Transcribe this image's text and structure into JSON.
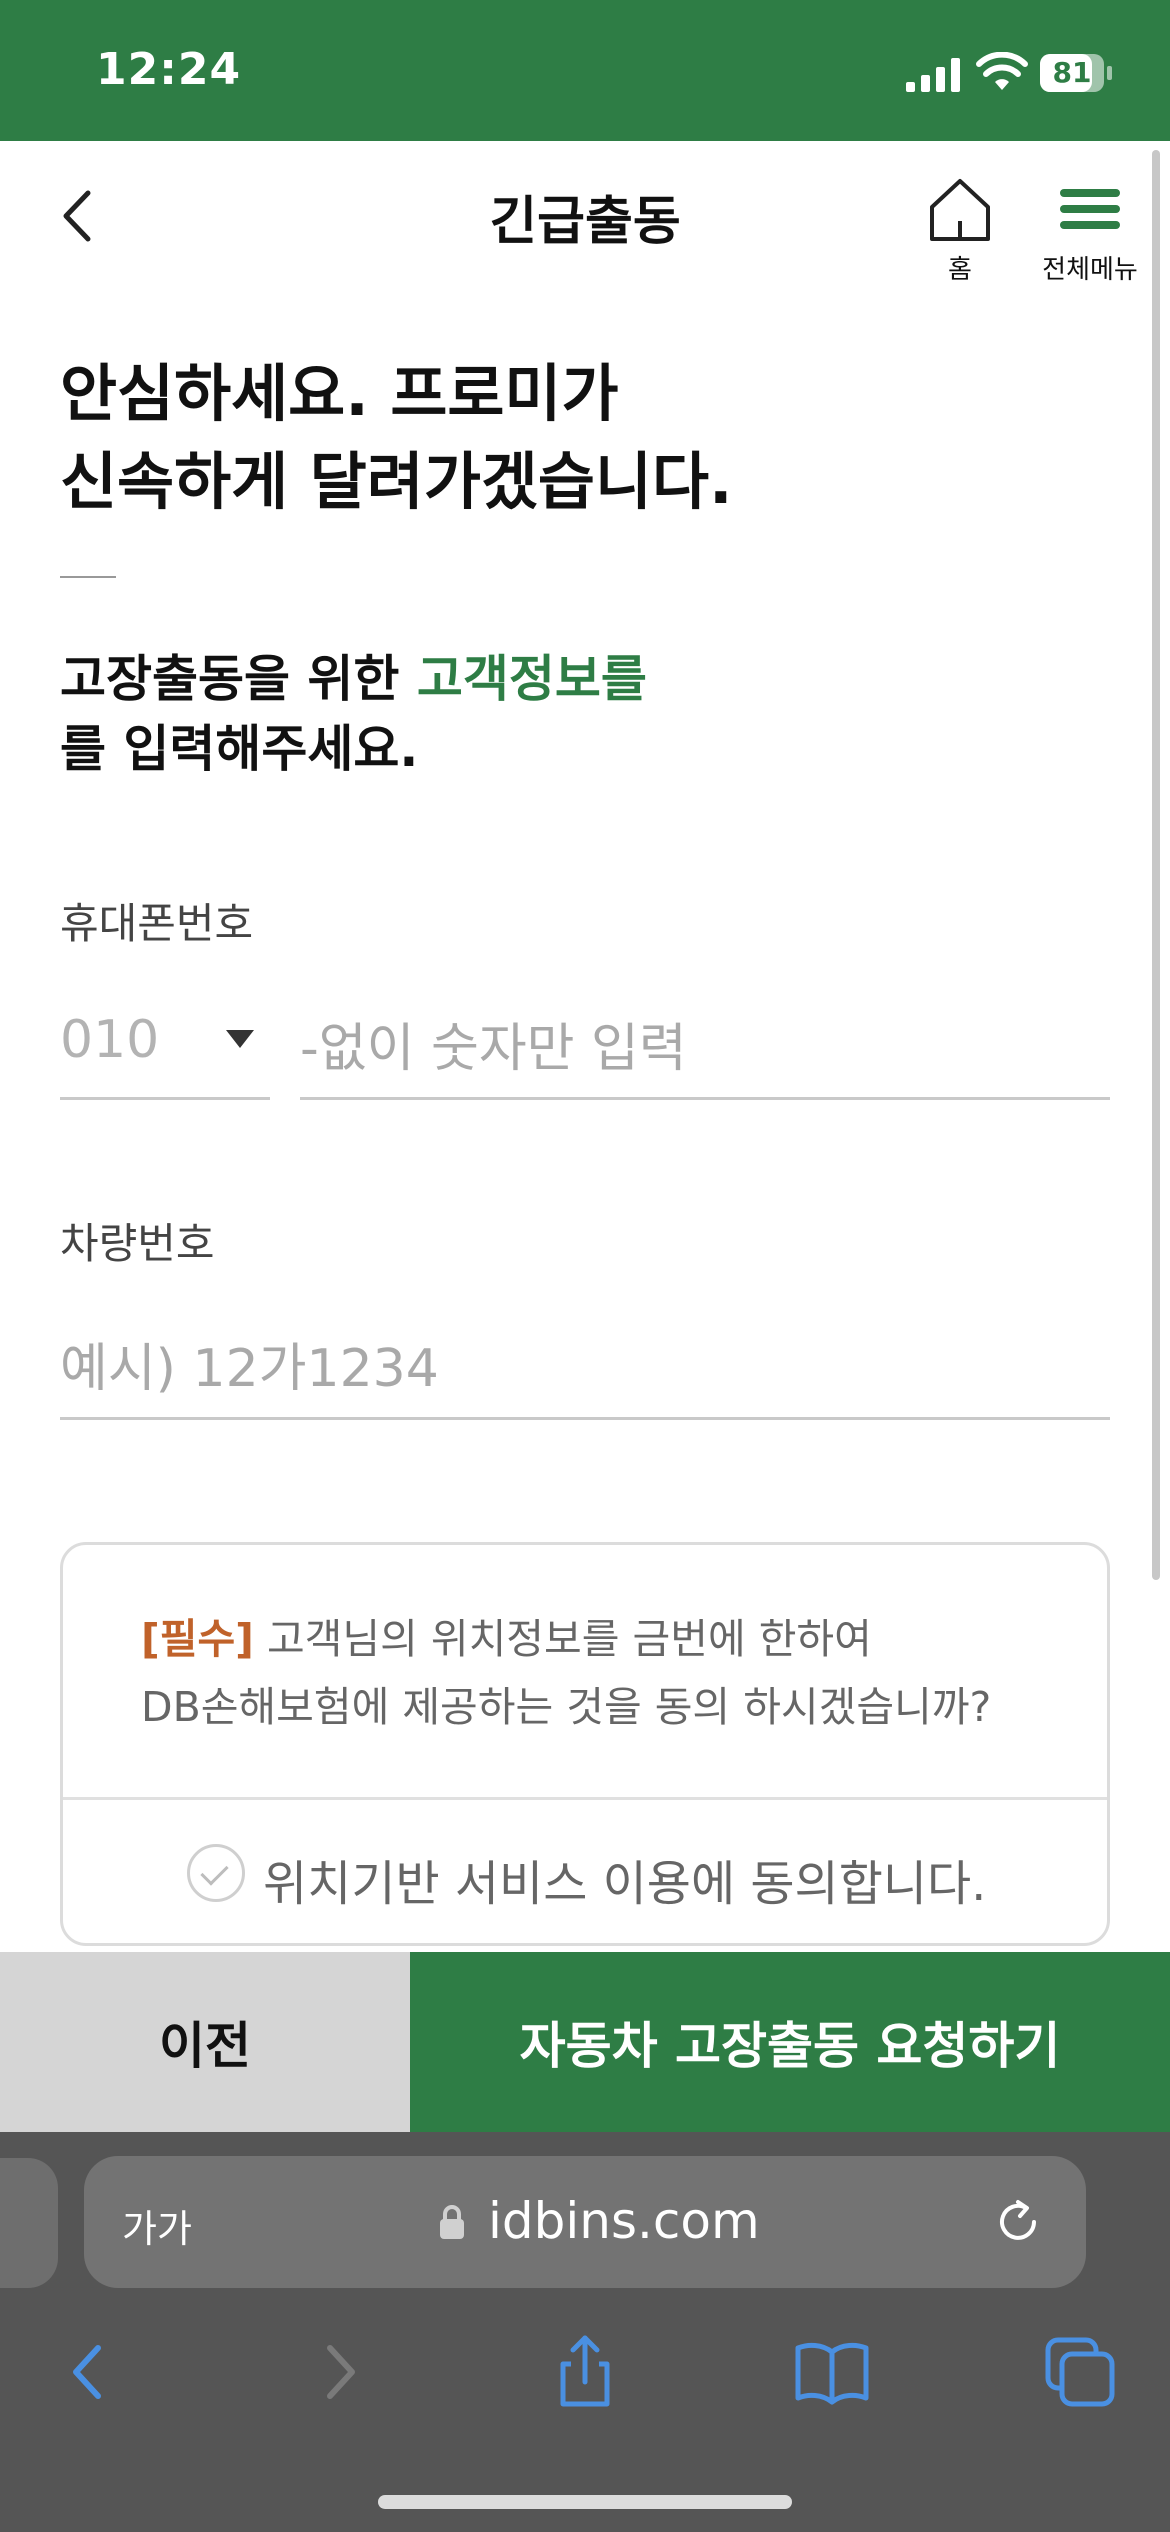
{
  "status_bar": {
    "time": "12:24",
    "battery": "81"
  },
  "header": {
    "title": "긴급출동",
    "home_label": "홈",
    "menu_label": "전체메뉴"
  },
  "headline": {
    "line1": "안심하세요. 프로미가",
    "line2": "신속하게 달려가겠습니다."
  },
  "subhead": {
    "prefix": "고장출동을 위한 ",
    "accent": "고객정보를",
    "suffix": "를 입력해주세요."
  },
  "phone": {
    "label": "휴대폰번호",
    "prefix_value": "010",
    "placeholder": "-없이 숫자만 입력"
  },
  "vehicle": {
    "label": "차량번호",
    "placeholder": "예시) 12가1234"
  },
  "consent": {
    "required_tag": "[필수]",
    "text_line1": " 고객님의 위치정보를 금번에 한하여",
    "text_line2": "DB손해보험에 제공하는 것을 동의 하시겠습니까?",
    "agree_label": "위치기반 서비스 이용에 동의합니다."
  },
  "buttons": {
    "prev": "이전",
    "request": "자동차 고장출동 요청하기"
  },
  "browser": {
    "aa_label": "가가",
    "url": "idbins.com"
  },
  "colors": {
    "brand_green": "#2e7d45",
    "required_orange": "#c0622a",
    "safari_blue": "#4a90e2"
  }
}
